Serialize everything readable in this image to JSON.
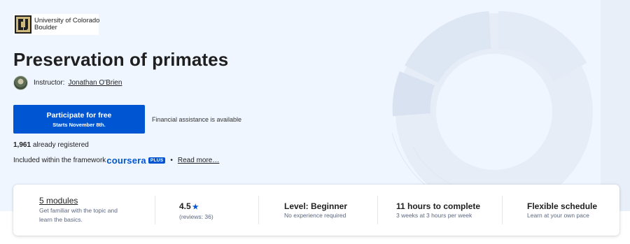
{
  "brand": {
    "university_line1": "University of Colorado",
    "university_line2": "Boulder",
    "logo_icon": "cu-boulder-logo-icon",
    "accent": "#0056d2",
    "hero_bg": "#f0f6ff"
  },
  "course": {
    "title": "Preservation of primates",
    "instructor_label": "Instructor:",
    "instructor_name": "Jonathan O'Brien"
  },
  "cta": {
    "main_label": "Participate for free",
    "sub_label": "Starts November 8th.",
    "financial_aid": "Financial assistance is available"
  },
  "stats": {
    "registered_count": "1,961",
    "registered_text": "already registered"
  },
  "included": {
    "prefix": "Included within the framework",
    "coursera": "coursera",
    "plus": "PLUS",
    "bullet": "•",
    "read_more": "Read more…"
  },
  "info_card": {
    "modules": {
      "title": "5 modules",
      "desc_line1": "Get familiar with the topic and",
      "desc_line2": "learn the basics."
    },
    "rating": {
      "value": "4.5",
      "star": "★",
      "reviews": "(reviews: 36)"
    },
    "level": {
      "title": "Level: Beginner",
      "desc": "No experience required"
    },
    "duration": {
      "title": "11 hours to complete",
      "desc": "3 weeks at 3 hours per week"
    },
    "schedule": {
      "title": "Flexible schedule",
      "desc": "Learn at your own pace"
    }
  }
}
